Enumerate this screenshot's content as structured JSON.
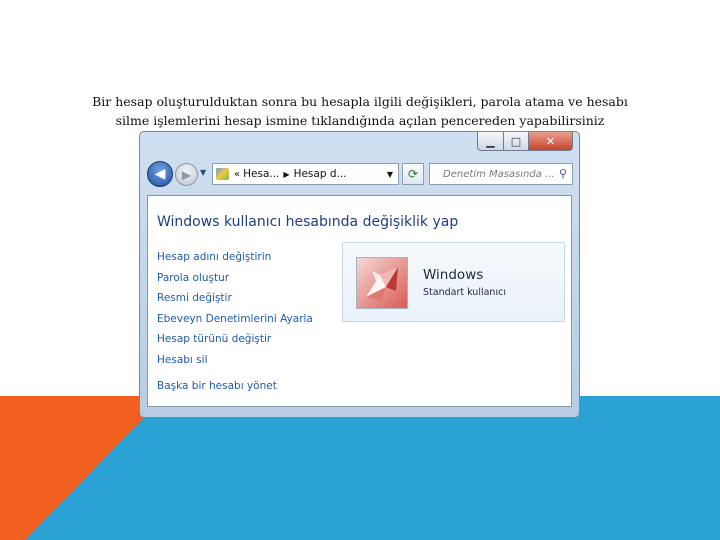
{
  "caption": {
    "line1": "Bir hesap oluşturulduktan sonra bu hesapla ilgili değişikleri, parola atama ve hesabı",
    "line2": "silme işlemlerini hesap ismine tıklandığında açılan pencereden yapabilirsiniz"
  },
  "window": {
    "controls": {
      "minimize": "▁",
      "maximize": "□",
      "close": "✕"
    },
    "nav": {
      "back_glyph": "◀",
      "forward_glyph": "▶",
      "history_glyph": "▼",
      "breadcrumb_sep": "«",
      "crumb1": "Hesa...",
      "crumb_arrow": "▶",
      "crumb2": "Hesap d...",
      "address_drop": "▼",
      "refresh_glyph": "⟳",
      "search_placeholder": "Denetim Masasında ...",
      "search_glyph": "⚲"
    },
    "heading": "Windows kullanıcı hesabında değişiklik yap",
    "links": [
      "Hesap adını değiştirin",
      "Parola oluştur",
      "Resmi değiştir",
      "Ebeveyn Denetimlerini Ayarla",
      "Hesap türünü değiştir",
      "Hesabı sil"
    ],
    "other_link": "Başka bir hesabı yönet",
    "account": {
      "name": "Windows",
      "type": "Standart kullanıcı"
    }
  },
  "icons": {
    "back": "back-arrow-icon",
    "forward": "forward-arrow-icon",
    "control_panel": "control-panel-icon",
    "refresh": "refresh-icon",
    "search": "search-icon",
    "avatar": "origami-crane-icon"
  },
  "colors": {
    "orange_bg": "#f2601f",
    "blue_bg": "#2aa2d6",
    "link": "#1e5bb0",
    "heading": "#1e3d8a"
  }
}
